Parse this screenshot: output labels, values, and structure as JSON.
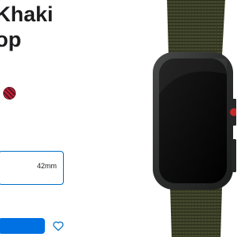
{
  "product": {
    "title_lines": [
      "Khaki",
      "op"
    ]
  },
  "band_options": {
    "selected_swatch": {
      "color": "#c62038"
    }
  },
  "case_size": {
    "option_label": "42mm"
  },
  "actions": {
    "add_button_color": "#0071e3",
    "favorite_icon": "heart-icon"
  },
  "colors": {
    "accent": "#0070c9",
    "band": "#3b3e26",
    "case": "#2f3030"
  }
}
